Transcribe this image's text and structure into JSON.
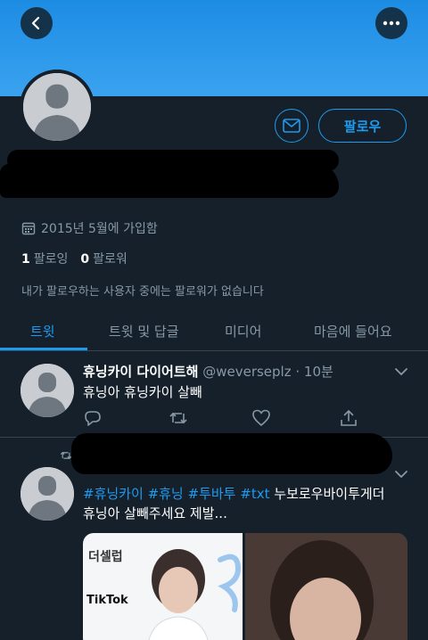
{
  "header": {
    "back_icon": "chevron-left-icon",
    "more_icon": "ellipsis-icon",
    "banner_color": "#1d8fe6"
  },
  "profile": {
    "joined": "2015년 5월에 가입함",
    "following_count": "1",
    "following_label": "팔로잉",
    "followers_count": "0",
    "followers_label": "팔로워",
    "mutual_note": "내가 팔로우하는 사용자 중에는 팔로워가 없습니다",
    "follow_button": "팔로우",
    "message_icon": "envelope-icon"
  },
  "tabs": [
    {
      "label": "트윗",
      "active": true
    },
    {
      "label": "트윗 및 답글",
      "active": false
    },
    {
      "label": "미디어",
      "active": false
    },
    {
      "label": "마음에 들어요",
      "active": false
    }
  ],
  "tweets": [
    {
      "name": "휴닝카이 다이어트해",
      "meta": "@weverseplz · 10분",
      "text": "휴닝아 휴닝카이 살빼"
    },
    {
      "hashtags": [
        "#휴닝카이",
        "#휴닝",
        "#투바투",
        "#txt"
      ],
      "text_rest": "누보로우바이투게더",
      "text_line2": "휴닝아 살빼주세요 제발...",
      "media_brand": "더셀럽",
      "media_tiktok": "TikTok"
    }
  ],
  "colors": {
    "accent": "#1d9bf0",
    "background": "#15202b",
    "secondary_text": "#8899a6"
  }
}
